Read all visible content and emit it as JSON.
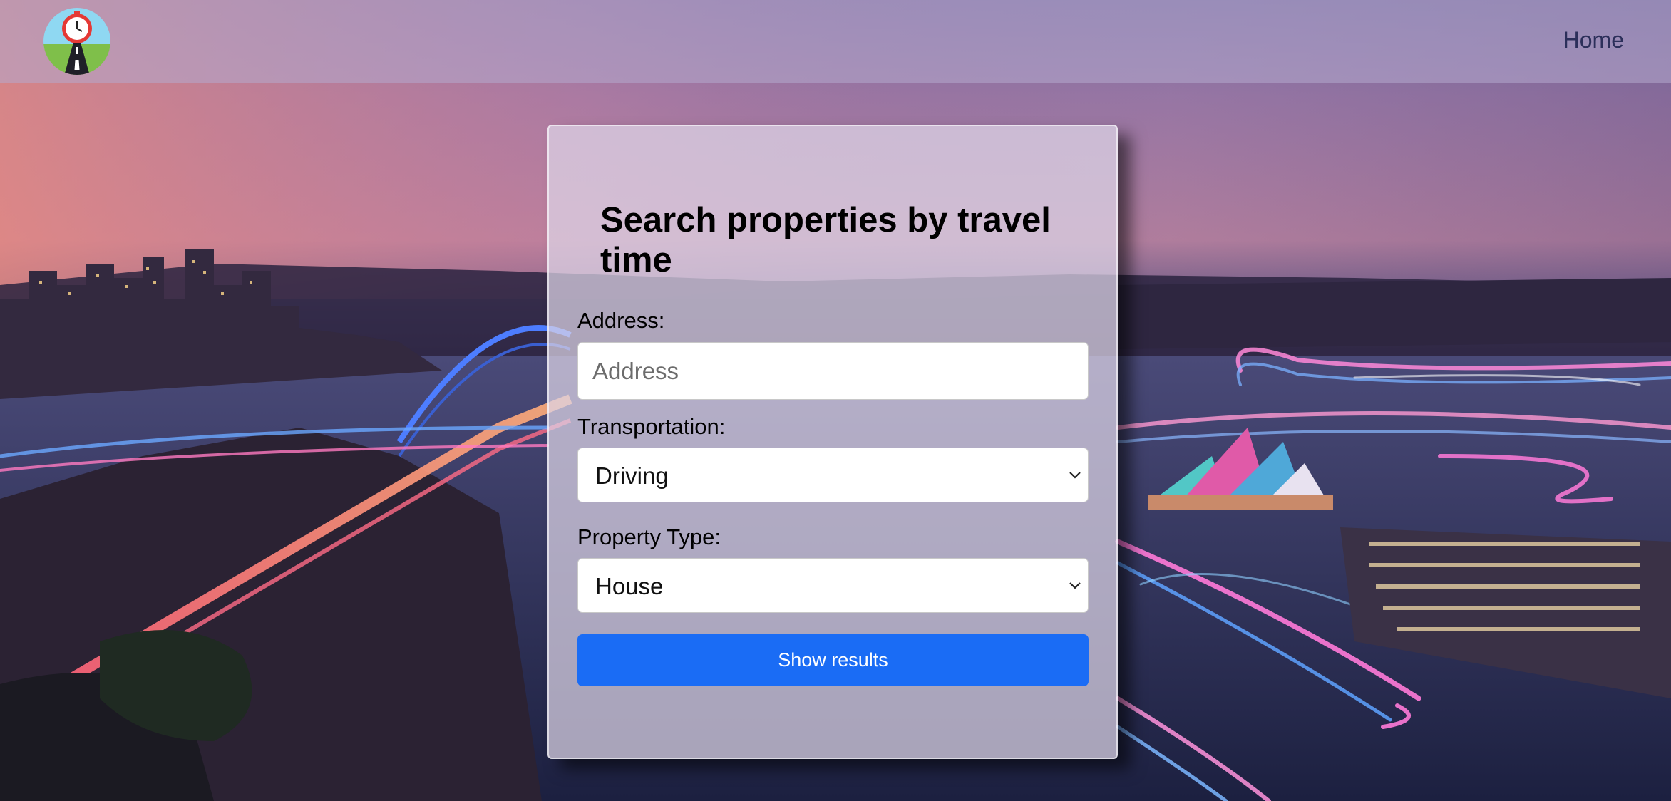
{
  "navbar": {
    "logo_icon": "clock-road-logo-icon",
    "home_label": "Home"
  },
  "search_form": {
    "title": "Search properties by travel time",
    "address": {
      "label": "Address:",
      "placeholder": "Address",
      "value": ""
    },
    "transportation": {
      "label": "Transportation:",
      "selected": "Driving",
      "icon": "chevron-down-icon"
    },
    "property_type": {
      "label": "Property Type:",
      "selected": "House",
      "icon": "chevron-down-icon"
    },
    "submit_label": "Show results"
  },
  "colors": {
    "accent": "#1a6cf5",
    "navbar_text": "#2c2f5a",
    "card_bg": "#ded6e8"
  }
}
